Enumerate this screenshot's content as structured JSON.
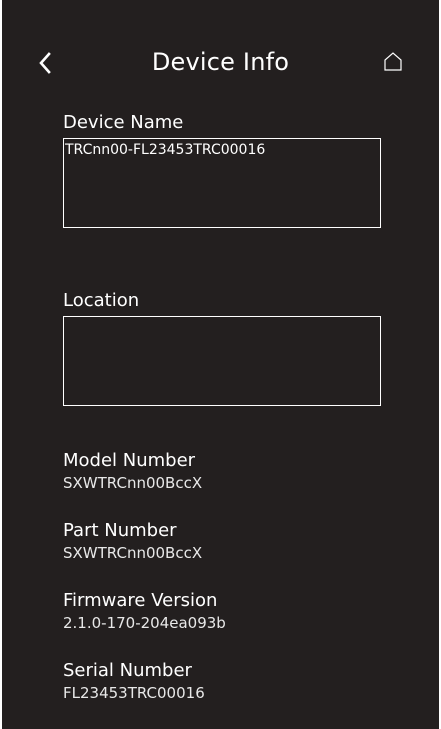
{
  "header": {
    "title": "Device Info",
    "back_icon": "chevron-left-icon",
    "home_icon": "home-outline-icon"
  },
  "device_name": {
    "label": "Device Name",
    "value": "TRCnn00-FL23453TRC00016"
  },
  "location": {
    "label": "Location",
    "value": ""
  },
  "info": [
    {
      "label": "Model Number",
      "value": "SXWTRCnn00BccX"
    },
    {
      "label": "Part Number",
      "value": "SXWTRCnn00BccX"
    },
    {
      "label": "Firmware Version",
      "value": "2.1.0-170-204ea093b"
    },
    {
      "label": "Serial Number",
      "value": "FL23453TRC00016"
    }
  ],
  "colors": {
    "background": "#231f1f",
    "text": "#ffffff"
  }
}
